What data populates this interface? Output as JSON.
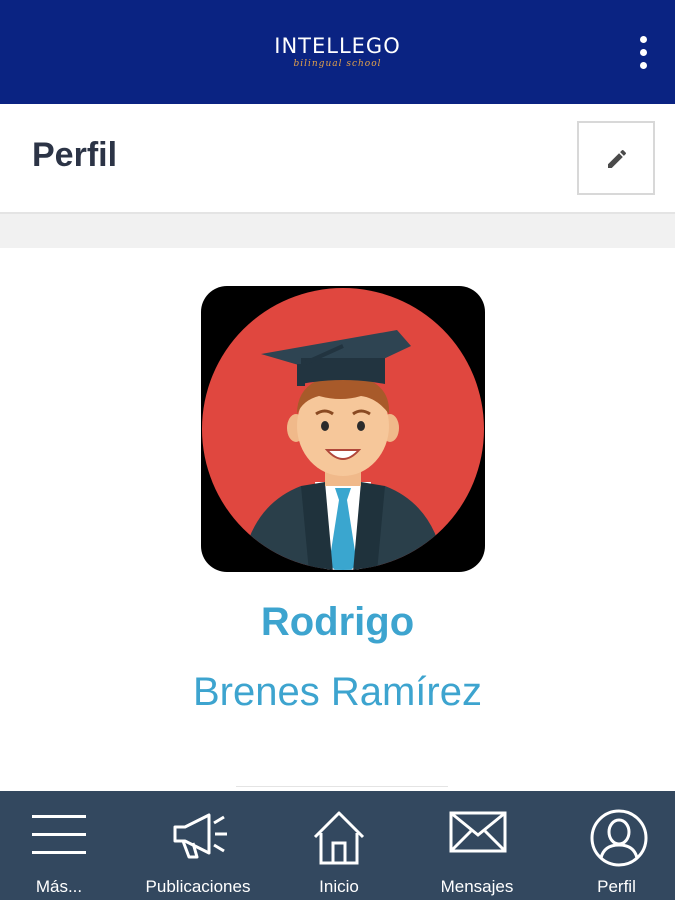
{
  "app": {
    "logo_text": "INTELLEGO",
    "logo_subtitle": "bilingual school"
  },
  "header": {
    "title": "Perfil"
  },
  "profile": {
    "first_name": "Rodrigo",
    "last_name": "Brenes Ramírez"
  },
  "bottom_nav": {
    "items": [
      {
        "label": "Más...",
        "icon": "hamburger-icon"
      },
      {
        "label": "Publicaciones",
        "icon": "megaphone-icon"
      },
      {
        "label": "Inicio",
        "icon": "home-icon"
      },
      {
        "label": "Mensajes",
        "icon": "envelope-icon"
      },
      {
        "label": "Perfil",
        "icon": "user-icon"
      }
    ]
  },
  "colors": {
    "top_bar": "#0a2382",
    "bottom_bar": "#33485f",
    "accent": "#3da4cf",
    "logo_subtitle": "#e4a24a"
  }
}
